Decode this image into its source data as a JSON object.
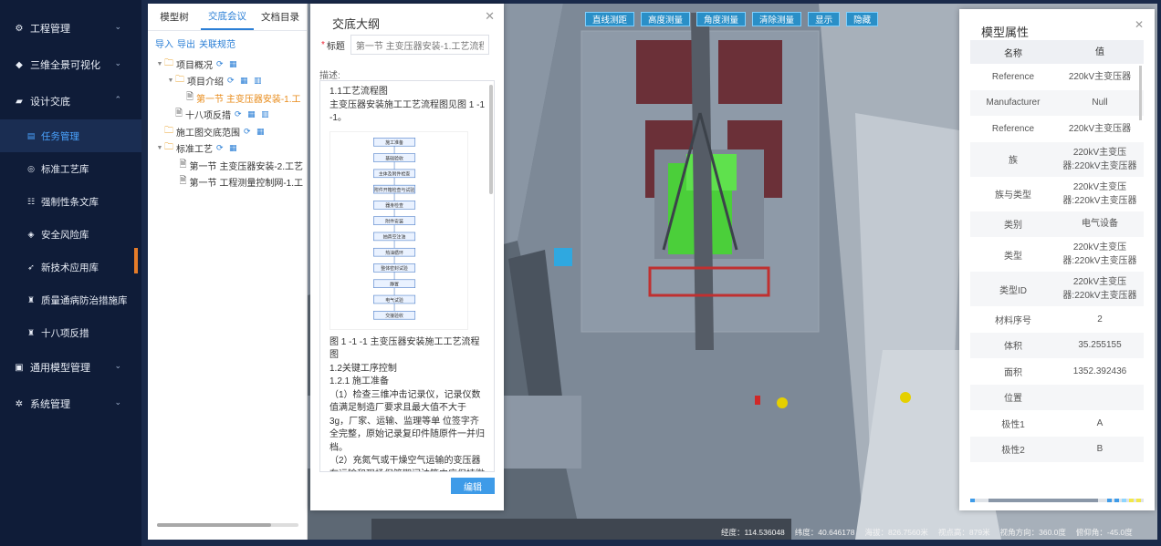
{
  "sidebar": {
    "items": [
      {
        "label": "工程管理",
        "icon": "project-icon",
        "glyph": "⚙"
      },
      {
        "label": "三维全景可视化",
        "icon": "cube-icon",
        "glyph": "◆"
      },
      {
        "label": "设计交底",
        "icon": "design-icon",
        "glyph": "▰"
      }
    ],
    "sub_items": [
      {
        "label": "任务管理",
        "icon": "task-icon",
        "glyph": "▤"
      },
      {
        "label": "标准工艺库",
        "icon": "standard-icon",
        "glyph": "◎"
      },
      {
        "label": "强制性条文库",
        "icon": "rules-icon",
        "glyph": "☷"
      },
      {
        "label": "安全风险库",
        "icon": "shield-icon",
        "glyph": "◈"
      },
      {
        "label": "新技术应用库",
        "icon": "tech-icon",
        "glyph": "➶"
      },
      {
        "label": "质量通病防治措施库",
        "icon": "quality-icon",
        "glyph": "♜"
      },
      {
        "label": "十八项反措",
        "icon": "measures-icon",
        "glyph": "♜"
      }
    ],
    "bottom_items": [
      {
        "label": "通用模型管理",
        "icon": "model-icon",
        "glyph": "▣"
      },
      {
        "label": "系统管理",
        "icon": "gear-icon",
        "glyph": "✲"
      }
    ]
  },
  "tree": {
    "tabs": [
      "模型树",
      "交底会议",
      "文档目录"
    ],
    "actions": [
      "导入",
      "导出",
      "关联规范"
    ],
    "nodes": [
      {
        "label": "项目概况",
        "level": 0,
        "type": "folder",
        "arrow": "▼",
        "acts": "⟳ ▦"
      },
      {
        "label": "项目介绍",
        "level": 1,
        "type": "folder",
        "arrow": "▼",
        "acts": "⟳ ▦ ▥"
      },
      {
        "label": "第一节 主变压器安装-1.工",
        "level": 2,
        "type": "doc",
        "arrow": "",
        "acts": "",
        "active": true
      },
      {
        "label": "十八项反措",
        "level": 1,
        "type": "doc",
        "arrow": "",
        "acts": "⟳ ▦ ▥"
      },
      {
        "label": "施工图交底范围",
        "level": 0,
        "type": "folder",
        "arrow": "",
        "acts": "⟳ ▦"
      },
      {
        "label": "标准工艺",
        "level": 0,
        "type": "folder",
        "arrow": "▼",
        "acts": "⟳ ▦"
      },
      {
        "label": "第一节 主变压器安装-2.工艺",
        "level": 2,
        "type": "doc",
        "arrow": "",
        "acts": ""
      },
      {
        "label": "第一节 工程测量控制网-1.工",
        "level": 2,
        "type": "doc",
        "arrow": "",
        "acts": ""
      }
    ]
  },
  "outline": {
    "title": "交底大纲",
    "title_label": "标题",
    "title_value": "第一节 主变压器安装-1.工艺流程",
    "desc_label": "描述:",
    "desc_top": [
      "1.1工艺流程图",
      "主变压器安装施工工艺流程图见图 1 -1 -1。"
    ],
    "desc_bottom": [
      "图 1 -1 -1 主变压器安装施工工艺流程图",
      "1.2关键工序控制",
      "1.2.1 施工准备",
      "（1）检查三维冲击记录仪，记录仪数值满足制造厂要求且最大值不大于 3g，厂家、运输、监理等单 位签字齐全完整，原始记录复印件随原件一并归档。",
      "（2）充氮气或干燥空气运输的变压器在运输和现场保管期间油箱内应保持微正"
    ],
    "flowchart_steps": [
      "施工准备",
      "基础验收",
      "主体及附件检查",
      "附件开箱检查与试验",
      "器身检查",
      "附件安装",
      "抽真空注油",
      "热油循环",
      "整体密封试验",
      "静置",
      "电气试验",
      "交接验收"
    ],
    "edit_label": "编辑"
  },
  "toolbar": {
    "buttons": [
      "直线测距",
      "高度测量",
      "角度测量",
      "清除测量",
      "显示",
      "隐藏"
    ]
  },
  "props": {
    "title": "模型属性",
    "header": [
      "名称",
      "值"
    ],
    "rows": [
      {
        "k": "Reference",
        "v": "220kV主变压器"
      },
      {
        "k": "Manufacturer",
        "v": "Null"
      },
      {
        "k": "Reference",
        "v": "220kV主变压器"
      },
      {
        "k": "族",
        "v": "220kV主变压器:220kV主变压器"
      },
      {
        "k": "族与类型",
        "v": "220kV主变压器:220kV主变压器"
      },
      {
        "k": "类别",
        "v": "电气设备"
      },
      {
        "k": "类型",
        "v": "220kV主变压器:220kV主变压器"
      },
      {
        "k": "类型ID",
        "v": "220kV主变压器:220kV主变压器"
      },
      {
        "k": "材料序号",
        "v": "2"
      },
      {
        "k": "体积",
        "v": "35.255155"
      },
      {
        "k": "面积",
        "v": "1352.392436"
      },
      {
        "k": "位置",
        "v": ""
      },
      {
        "k": "极性1",
        "v": "A"
      },
      {
        "k": "极性2",
        "v": "B"
      }
    ]
  },
  "status": [
    "经度：114.536048",
    "纬度：40.646178",
    "海拔：826.7560米",
    "视点高：879米",
    "视角方向：360.0度",
    "俯仰角：-45.0度"
  ],
  "colors": {
    "accent": "#2b7fd6",
    "active_tree": "#e88b1a",
    "sidebar_bg": "#0f1c38",
    "button": "#3e9be8"
  }
}
